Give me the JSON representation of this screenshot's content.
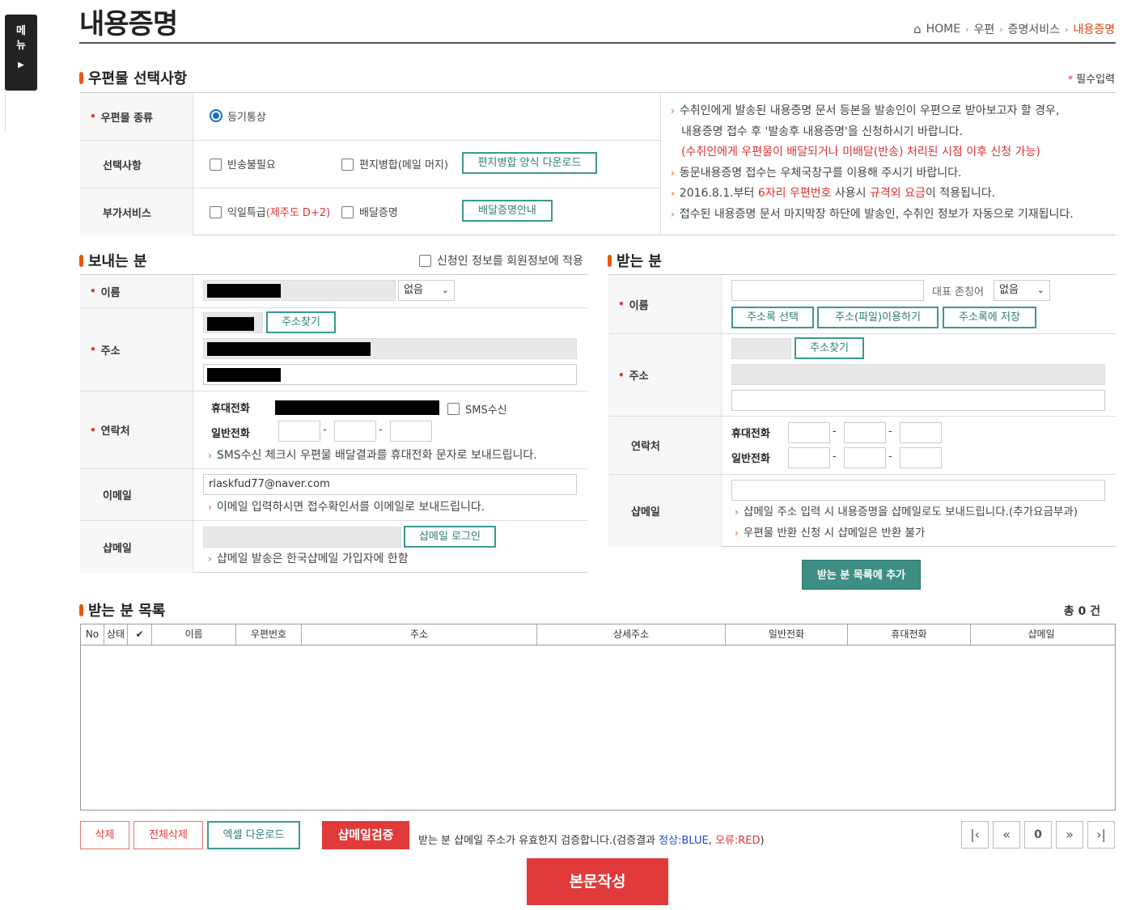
{
  "side_menu": {
    "label_1": "메",
    "label_2": "뉴"
  },
  "page_title": "내용증명",
  "breadcrumb": [
    "HOME",
    "우편",
    "증명서비스",
    "내용증명"
  ],
  "section_mail": {
    "title": "우편물 선택사항",
    "required_note": "필수입력"
  },
  "mail_options": {
    "type_label": "우편물 종류",
    "type_value": "등기통상",
    "select_label": "선택사항",
    "opt_no_return": "반송불필요",
    "opt_merge": "편지병합(메일 머지)",
    "merge_download_btn": "편지병합 양식 다운로드",
    "extra_label": "부가서비스",
    "opt_next_day_a": "익일특급",
    "opt_next_day_b": "(제주도 D+2)",
    "opt_delivery_proof": "배달증명",
    "delivery_info_btn": "배달증명안내"
  },
  "info_notes": {
    "n1_a": "수취인에게 발송된 내용증명 문서 등본을 발송인이 우편으로 받아보고자 할 경우,",
    "n1_b": "내용증명 접수 후 '발송후 내용증명'을 신청하시기 바랍니다.",
    "n1_c": "(수취인에게 우편물이 배달되거나 미배달(반송) 처리된 시점 이후 신청 가능)",
    "n2": "동문내용증명 접수는 우체국창구를 이용해 주시기 바랍니다.",
    "n3_a": "2016.8.1.부터 ",
    "n3_b": "6자리 우편번호",
    "n3_c": " 사용시 ",
    "n3_d": "규격외 요금",
    "n3_e": "이 적용됩니다.",
    "n4": "접수된 내용증명 문서 마지막장 하단에 발송인, 수취인 정보가 자동으로 기재됩니다."
  },
  "sender": {
    "title": "보내는 분",
    "apply_member": "신청인 정보를 회원정보에 적용",
    "name_label": "이름",
    "name_select": "없음",
    "addr_label": "주소",
    "addr_btn": "주소찾기",
    "contact_label": "연락처",
    "mobile_label": "휴대전화",
    "sms_label": "SMS수신",
    "phone_label": "일반전화",
    "sms_note": "SMS수신 체크시 우편물 배달결과를 휴대전화 문자로 보내드립니다.",
    "email_label": "이메일",
    "email_value": "rlaskfud77@naver.com",
    "email_note": "이메일 입력하시면 접수확인서를 이메일로 보내드립니다.",
    "shopmail_label": "샵메일",
    "shopmail_btn": "샵메일 로그인",
    "shopmail_note": "샵메일 발송은 한국샵메일 가입자에 한함"
  },
  "receiver": {
    "title": "받는 분",
    "name_label": "이름",
    "title_label": "대표 존칭어",
    "title_select": "없음",
    "btn_addrbook": "주소록 선택",
    "btn_file": "주소(파일)이용하기",
    "btn_save": "주소록에 저장",
    "addr_label": "주소",
    "addr_btn": "주소찾기",
    "contact_label": "연락처",
    "mobile_label": "휴대전화",
    "phone_label": "일반전화",
    "shopmail_label": "샵메일",
    "shopmail_note1": "샵메일 주소 입력 시 내용증명을 샵메일로도 보내드립니다.(추가요금부과)",
    "shopmail_note2": "우편물 반환 신청 시 샵메일은 반환 불가",
    "add_btn": "받는 분 목록에 추가"
  },
  "receiver_list": {
    "title": "받는 분 목록",
    "total": "총 0 건",
    "columns": [
      "No",
      "상태",
      "✔",
      "이름",
      "우편번호",
      "주소",
      "상세주소",
      "일반전화",
      "휴대전화",
      "샵메일"
    ]
  },
  "bottom": {
    "delete_btn": "삭제",
    "delete_all_btn": "전체삭제",
    "excel_btn": "엑셀 다운로드",
    "verify_btn": "샵메일검증",
    "verify_note_a": "받는 분 샵메일 주소가 유효한지 검증합니다.(검증결과 ",
    "verify_note_b": "정상:BLUE",
    "verify_note_c": ", ",
    "verify_note_d": "오류:RED",
    "verify_note_e": ")",
    "page_num": "0",
    "write_btn": "본문작성"
  },
  "colors": {
    "accent": "#e8590c",
    "teal": "#3a9a8e",
    "red_btn": "#e03a3a"
  }
}
